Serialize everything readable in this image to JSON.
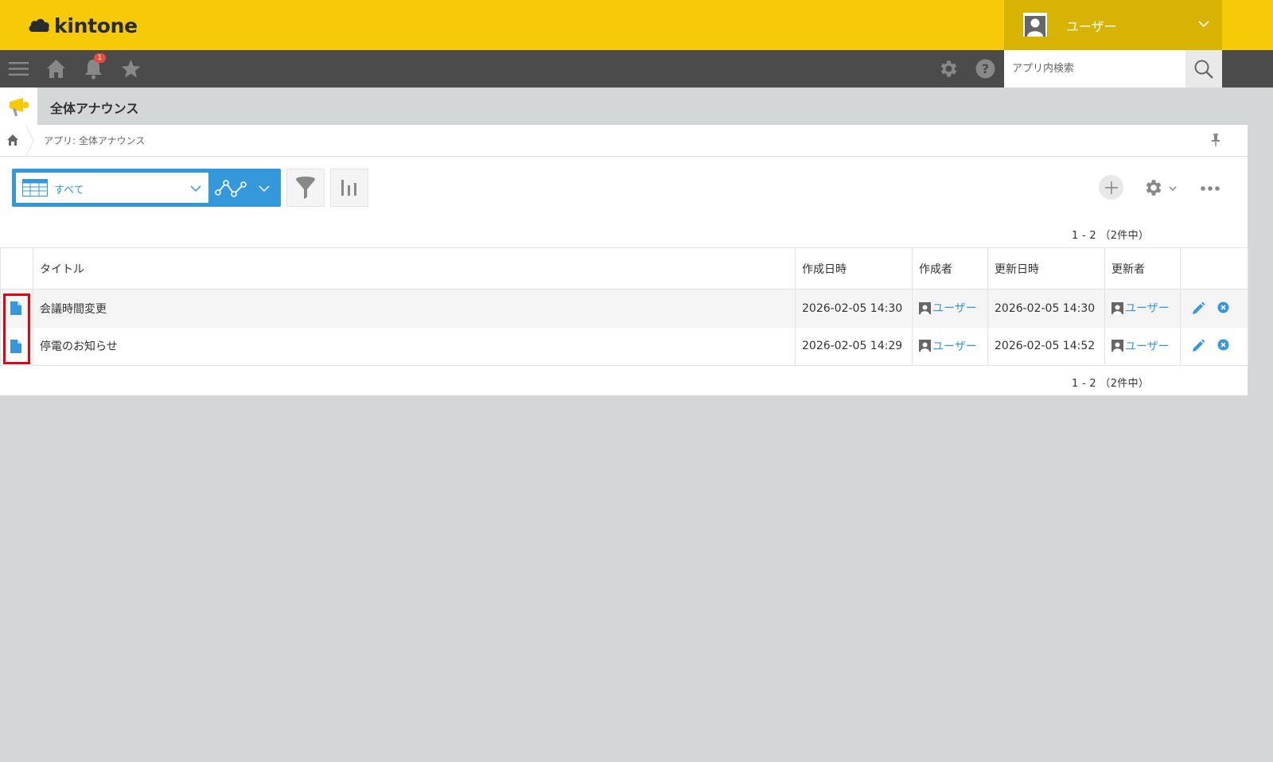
{
  "header": {
    "logo_text": "kintone",
    "user_name": "ユーザー",
    "notification_count": "1",
    "search_placeholder": "アプリ内検索"
  },
  "app": {
    "title": "全体アナウンス",
    "breadcrumb": "アプリ: 全体アナウンス"
  },
  "toolbar": {
    "view_label": "すべて"
  },
  "pager": {
    "top": "1 - 2 （2件中）",
    "bottom": "1 - 2 （2件中）"
  },
  "table": {
    "columns": [
      "",
      "タイトル",
      "作成日時",
      "作成者",
      "更新日時",
      "更新者",
      ""
    ],
    "rows": [
      {
        "title": "会議時間変更",
        "created_at": "2026-02-05 14:30",
        "creator": "ユーザー",
        "updated_at": "2026-02-05 14:30",
        "updater": "ユーザー"
      },
      {
        "title": "停電のお知らせ",
        "created_at": "2026-02-05 14:29",
        "creator": "ユーザー",
        "updated_at": "2026-02-05 14:52",
        "updater": "ユーザー"
      }
    ]
  },
  "colors": {
    "brand_yellow": "#f6ca06",
    "nav_dark": "#4b4b4b",
    "accent_blue": "#3498db",
    "highlight_red": "#e60012"
  }
}
